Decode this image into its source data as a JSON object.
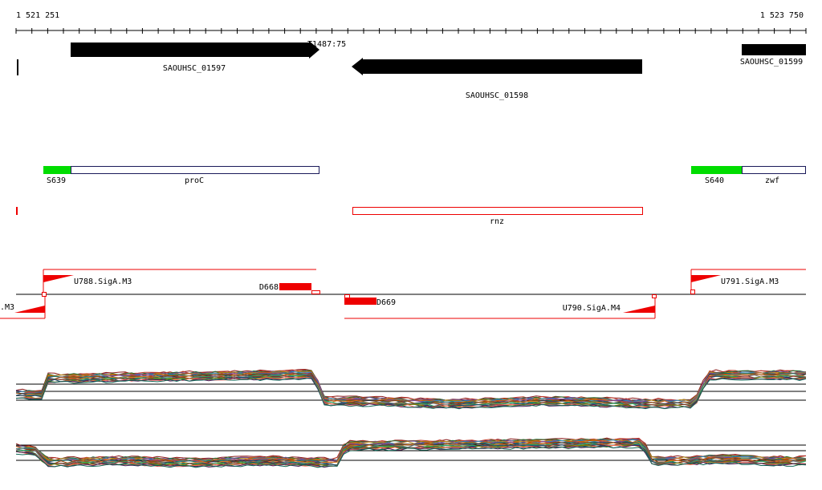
{
  "ruler": {
    "start_label": "1 521 251",
    "end_label": "1 523 750"
  },
  "features": {
    "marker_label": "T1487:75",
    "genes": {
      "g1597": "SAOUHSC_01597",
      "g1598": "SAOUHSC_01598",
      "g1599": "SAOUHSC_01599"
    },
    "operons": {
      "s639": "S639",
      "proc": "proC",
      "s640": "S640",
      "zwf": "zwf",
      "rnz": "rnz"
    },
    "promoters": {
      "m3_left": ".M3",
      "u788": "U788.SigA.M3",
      "d668": "D668",
      "d669": "D669",
      "u790": "U790.SigA.M4",
      "u791": "U791.SigA.M3"
    }
  },
  "colors": {
    "gene_arrow": "#000000",
    "sigma_green": "#00dd00",
    "feature_red": "#ee0000",
    "outline_navy": "#1a1a5a"
  }
}
